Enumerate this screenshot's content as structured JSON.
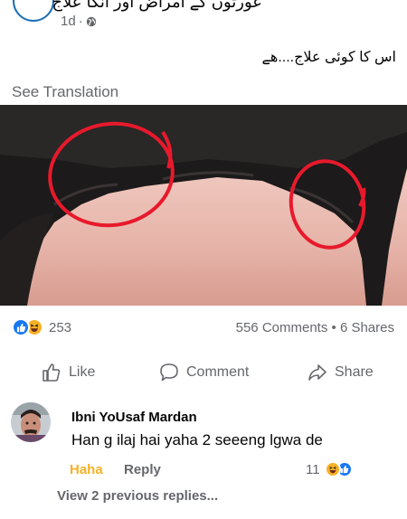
{
  "post": {
    "page_name": "عورتوں کے امراض اور انکا علاج",
    "time": "1d",
    "separator": "·",
    "text": "اس کا کوئی علاج....ھے",
    "see_translation": "See Translation"
  },
  "stats": {
    "reactions_count": "253",
    "comments": "556 Comments",
    "dot": "•",
    "shares": "6 Shares"
  },
  "actions": {
    "like": "Like",
    "comment": "Comment",
    "share": "Share"
  },
  "comment": {
    "author": "Ibni YoUsaf Mardan",
    "text": "Han g ilaj hai yaha 2 seeeng lgwa de",
    "reaction_label": "Haha",
    "reply_label": "Reply",
    "reaction_count": "11",
    "view_previous": "View 2 previous replies..."
  },
  "colors": {
    "like_blue": "#1877f2",
    "haha_yellow": "#f7b125",
    "meta_gray": "#65676b",
    "circle_red": "#e8192c"
  }
}
